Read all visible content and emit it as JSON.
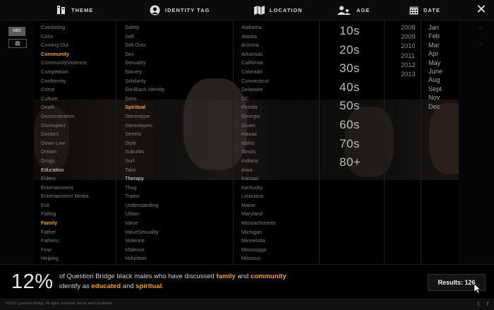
{
  "nav": {
    "theme": "THEME",
    "identity": "IDENTITY TAG",
    "location": "LOCATION",
    "age": "AGE",
    "date": "DATE",
    "close": "✕"
  },
  "tools": {
    "abc": "ABC",
    "scale": "⚖"
  },
  "themes": [
    "Coexisting",
    "Color",
    "Coming Out",
    "Community",
    "CommunityViolence",
    "Competition",
    "Conformity",
    "Crime",
    "Culture",
    "Death",
    "Demonstration",
    "Disrespect",
    "Doctors",
    "Down Low",
    "Dream",
    "Drugs",
    "Education",
    "Elders",
    "Entertainment",
    "Entertainment Media",
    "Evil",
    "Failing",
    "Family",
    "Father",
    "Fathers",
    "Fear",
    "Helping"
  ],
  "identity_tags": [
    "Safety",
    "Self",
    "Sell Outs",
    "Sex",
    "Sexuality",
    "Slavery",
    "Solidarity",
    "SonBlack Identity",
    "Sons",
    "Spiritual",
    "Stereotype",
    "Stereotypes",
    "Streets",
    "Style",
    "Suburbs",
    "Surf",
    "Take",
    "Therapy",
    "Thug",
    "Traitor",
    "Understanding",
    "Urban",
    "Value",
    "ValueSexuality",
    "Violence",
    "Vlolence",
    "Volunteer"
  ],
  "locations": [
    "Alabama",
    "Alaska",
    "Arizona",
    "Arkansas",
    "California",
    "Colorado",
    "Connecticut",
    "Delaware",
    "DC",
    "Florida",
    "Georgia",
    "Guam",
    "Hawaii",
    "Idaho",
    "Illinois",
    "Indiana",
    "Iowa",
    "Kansas",
    "Kentucky",
    "Louisiana",
    "Maine",
    "Maryland",
    "Massachusetts",
    "Michigan",
    "Minnesota",
    "Mississippi",
    "Missouri"
  ],
  "ages": [
    "10s",
    "20s",
    "30s",
    "40s",
    "50s",
    "60s",
    "70s",
    "80+"
  ],
  "years": [
    "2008",
    "2009",
    "2010",
    "2011",
    "2012",
    "2013"
  ],
  "months": [
    "Jan",
    "Feb",
    "Mar",
    "Apr",
    "May",
    "June",
    "Aug",
    "Sept",
    "Nov",
    "Dec"
  ],
  "highlight_themes": [
    "Community",
    "Family"
  ],
  "bright_themes": [
    "Education"
  ],
  "highlight_identity": [
    "Spiritual"
  ],
  "bright_identity": [
    "Therapy"
  ],
  "stat": {
    "percent": "12%",
    "line1_pre": "of Question Bridge black males who have discussed",
    "term1": "family",
    "and1": "and",
    "term2": "community",
    "line2_pre": "identify as",
    "term3": "educated",
    "and2": "and",
    "term4": "spiritual",
    "end": "."
  },
  "results_label": "Results: 126",
  "footer": {
    "copyright": "©2013 Question Bridge, All rights reserved. Terms and Conditions.",
    "twitter": "t",
    "facebook": "f"
  },
  "colors": {
    "accent": "#f0a02a",
    "background": "#000000"
  }
}
